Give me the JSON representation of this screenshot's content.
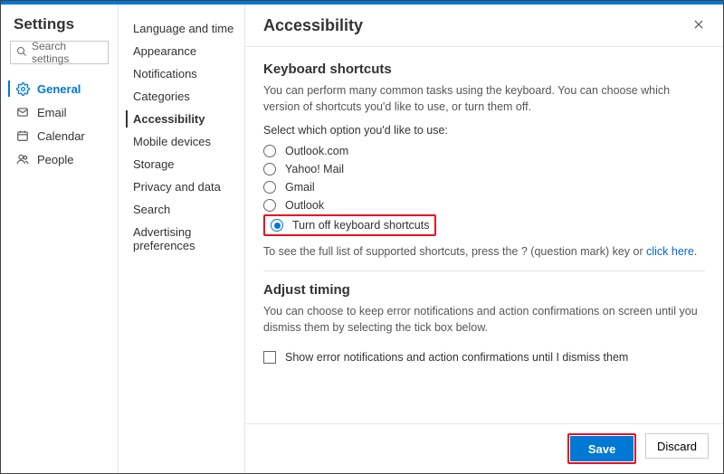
{
  "header": {
    "settings": "Settings"
  },
  "search": {
    "placeholder": "Search settings"
  },
  "leftNav": {
    "items": [
      {
        "key": "general",
        "label": "General"
      },
      {
        "key": "email",
        "label": "Email"
      },
      {
        "key": "calendar",
        "label": "Calendar"
      },
      {
        "key": "people",
        "label": "People"
      }
    ]
  },
  "subNav": {
    "items": [
      {
        "label": "Language and time"
      },
      {
        "label": "Appearance"
      },
      {
        "label": "Notifications"
      },
      {
        "label": "Categories"
      },
      {
        "label": "Accessibility"
      },
      {
        "label": "Mobile devices"
      },
      {
        "label": "Storage"
      },
      {
        "label": "Privacy and data"
      },
      {
        "label": "Search"
      },
      {
        "label": "Advertising preferences"
      }
    ],
    "activeIndex": 4
  },
  "page": {
    "title": "Accessibility",
    "keyboard": {
      "heading": "Keyboard shortcuts",
      "desc": "You can perform many common tasks using the keyboard. You can choose which version of shortcuts you'd like to use, or turn them off.",
      "prompt": "Select which option you'd like to use:",
      "options": [
        {
          "label": "Outlook.com"
        },
        {
          "label": "Yahoo! Mail"
        },
        {
          "label": "Gmail"
        },
        {
          "label": "Outlook"
        },
        {
          "label": "Turn off keyboard shortcuts"
        }
      ],
      "selectedIndex": 4,
      "hintPrefix": "To see the full list of supported shortcuts, press the ? (question mark) key or ",
      "hintLink": "click here",
      "hintSuffix": "."
    },
    "timing": {
      "heading": "Adjust timing",
      "desc": "You can choose to keep error notifications and action confirmations on screen until you dismiss them by selecting the tick box below.",
      "checkboxLabel": "Show error notifications and action confirmations until I dismiss them",
      "checked": false
    }
  },
  "footer": {
    "save": "Save",
    "discard": "Discard"
  }
}
